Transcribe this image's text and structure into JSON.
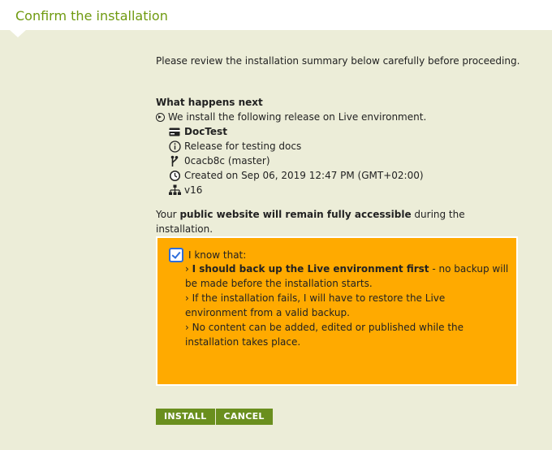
{
  "header": {
    "title": "Confirm the installation"
  },
  "intro": "Please review the installation summary below carefully before proceeding.",
  "next": {
    "heading": "What happens next",
    "description": "We install the following release on Live environment."
  },
  "release": {
    "name": "DocTest",
    "description": "Release for testing docs",
    "commit": "0cacb8c (master)",
    "created": "Created on Sep 06, 2019 12:47 PM (GMT+02:00)",
    "version": "v16",
    "icons": [
      "card-icon",
      "info-icon",
      "branch-icon",
      "clock-icon",
      "sitemap-icon"
    ]
  },
  "notice": {
    "prefix": "Your ",
    "bold": "public website will remain fully accessible",
    "suffix": " during the installation."
  },
  "ack": {
    "label": "I know that:",
    "checked": true,
    "cond1_bold": "I should back up the Live environment first",
    "cond1_rest": " - no backup will be made before the installation starts.",
    "cond2": "If the installation fails, I will have to restore the Live environment from a valid backup.",
    "cond3": "No content can be added, edited or published while the installation takes place.",
    "bullet": "›"
  },
  "buttons": {
    "install": "INSTALL",
    "cancel": "CANCEL"
  },
  "colors": {
    "page_bg": "#ecedd8",
    "title_green": "#6f9a10",
    "warning_orange": "#ffaa00",
    "button_green": "#6a8f1e",
    "checkbox_blue": "#2d6ddb"
  }
}
